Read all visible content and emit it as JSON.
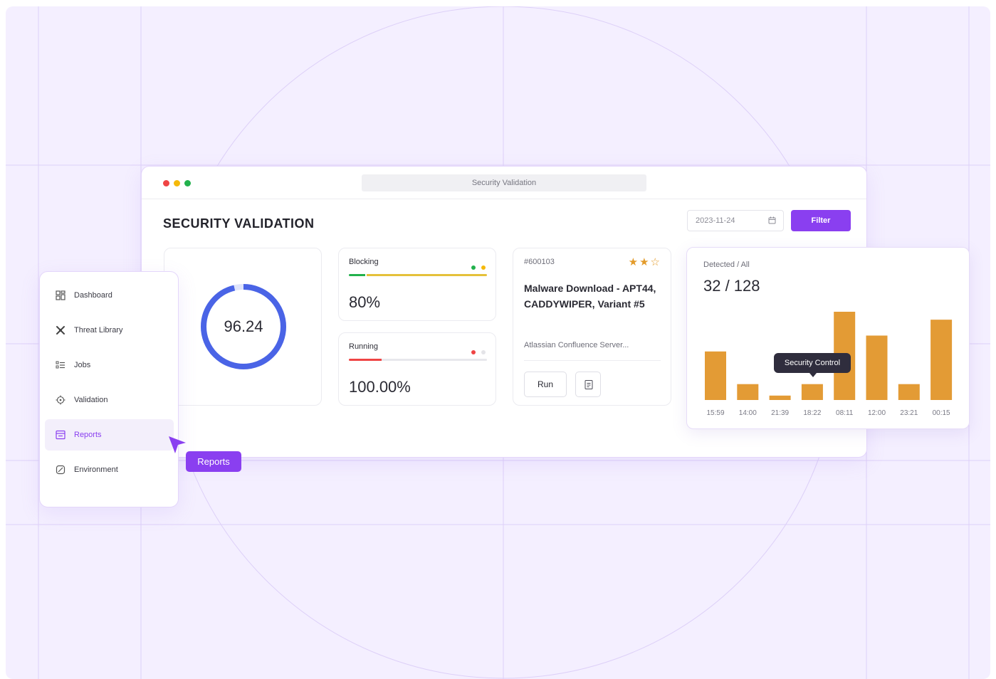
{
  "window": {
    "url": "Security Validation",
    "title": "SECURITY VALIDATION"
  },
  "toolbar": {
    "date_value": "2023-11-24",
    "filter_label": "Filter"
  },
  "score": {
    "value": "96.24",
    "fraction": 0.9624
  },
  "metrics": [
    {
      "label": "Blocking",
      "value": "80%",
      "dot_colors": [
        "#22b14c",
        "#f5b90a"
      ]
    },
    {
      "label": "Running",
      "value": "100.00%",
      "dot_colors": [
        "#ef4444",
        "#e4e4e8"
      ]
    }
  ],
  "job": {
    "id": "#600103",
    "rating": 2,
    "rating_max": 3,
    "title": "Malware Download - APT44, CADDYWIPER, Variant #5",
    "description": "Atlassian Confluence Server...",
    "run_label": "Run"
  },
  "detection": {
    "label": "Detected / All",
    "count": "32 / 128",
    "tooltip": "Security Control"
  },
  "chart_data": {
    "type": "bar",
    "categories": [
      "15:59",
      "14:00",
      "21:39",
      "18:22",
      "08:11",
      "12:00",
      "23:21",
      "00:15"
    ],
    "values": [
      55,
      18,
      5,
      18,
      100,
      73,
      18,
      91
    ],
    "color": "#e39b35"
  },
  "sidebar": {
    "items": [
      {
        "label": "Dashboard",
        "icon": "dashboard-icon",
        "active": false
      },
      {
        "label": "Threat Library",
        "icon": "threat-library-icon",
        "active": false
      },
      {
        "label": "Jobs",
        "icon": "jobs-icon",
        "active": false
      },
      {
        "label": "Validation",
        "icon": "validation-icon",
        "active": false
      },
      {
        "label": "Reports",
        "icon": "reports-icon",
        "active": true
      },
      {
        "label": "Environment",
        "icon": "environment-icon",
        "active": false
      }
    ]
  },
  "cursor": {
    "label": "Reports"
  },
  "colors": {
    "accent": "#8a3ff0",
    "donut": "#4a64e6",
    "bar": "#e39b35"
  }
}
